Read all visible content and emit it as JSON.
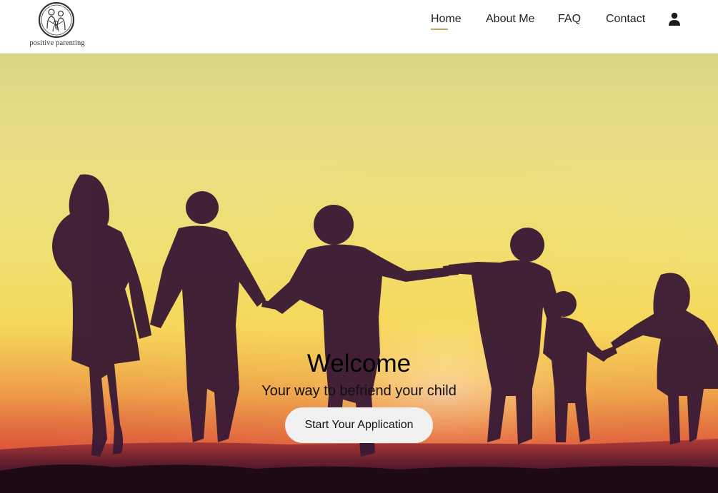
{
  "brand": {
    "logo_text": "positive parenting"
  },
  "nav": {
    "items": [
      {
        "label": "Home",
        "active": true
      },
      {
        "label": "About Me"
      },
      {
        "label": "FAQ"
      },
      {
        "label": "Contact"
      }
    ],
    "account_icon": "user-icon"
  },
  "hero": {
    "title": "Welcome",
    "subtitle": "Your way to befriend your child",
    "cta_label": "Start Your Application",
    "image": "children-silhouettes-sunset"
  },
  "colors": {
    "accent": "#c9a063",
    "button_bg": "#f1f1f1"
  }
}
